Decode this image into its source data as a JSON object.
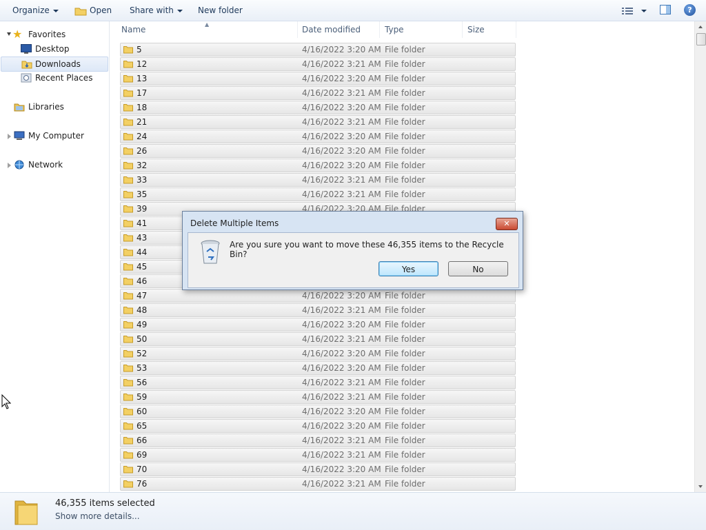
{
  "toolbar": {
    "organize": "Organize",
    "open": "Open",
    "share_with": "Share with",
    "new_folder": "New folder"
  },
  "nav": {
    "favorites": "Favorites",
    "desktop": "Desktop",
    "downloads": "Downloads",
    "recent_places": "Recent Places",
    "libraries": "Libraries",
    "my_computer": "My Computer",
    "network": "Network"
  },
  "columns": {
    "name": "Name",
    "date_modified": "Date modified",
    "type": "Type",
    "size": "Size"
  },
  "rows": [
    {
      "name": "5",
      "date": "4/16/2022 3:20 AM",
      "type": "File folder"
    },
    {
      "name": "12",
      "date": "4/16/2022 3:21 AM",
      "type": "File folder"
    },
    {
      "name": "13",
      "date": "4/16/2022 3:20 AM",
      "type": "File folder"
    },
    {
      "name": "17",
      "date": "4/16/2022 3:21 AM",
      "type": "File folder"
    },
    {
      "name": "18",
      "date": "4/16/2022 3:20 AM",
      "type": "File folder"
    },
    {
      "name": "21",
      "date": "4/16/2022 3:21 AM",
      "type": "File folder"
    },
    {
      "name": "24",
      "date": "4/16/2022 3:20 AM",
      "type": "File folder"
    },
    {
      "name": "26",
      "date": "4/16/2022 3:20 AM",
      "type": "File folder"
    },
    {
      "name": "32",
      "date": "4/16/2022 3:20 AM",
      "type": "File folder"
    },
    {
      "name": "33",
      "date": "4/16/2022 3:21 AM",
      "type": "File folder"
    },
    {
      "name": "35",
      "date": "4/16/2022 3:21 AM",
      "type": "File folder"
    },
    {
      "name": "39",
      "date": "4/16/2022 3:20 AM",
      "type": "File folder"
    },
    {
      "name": "41",
      "date": "",
      "type": ""
    },
    {
      "name": "43",
      "date": "",
      "type": ""
    },
    {
      "name": "44",
      "date": "",
      "type": ""
    },
    {
      "name": "45",
      "date": "",
      "type": ""
    },
    {
      "name": "46",
      "date": "",
      "type": ""
    },
    {
      "name": "47",
      "date": "4/16/2022 3:20 AM",
      "type": "File folder"
    },
    {
      "name": "48",
      "date": "4/16/2022 3:21 AM",
      "type": "File folder"
    },
    {
      "name": "49",
      "date": "4/16/2022 3:20 AM",
      "type": "File folder"
    },
    {
      "name": "50",
      "date": "4/16/2022 3:21 AM",
      "type": "File folder"
    },
    {
      "name": "52",
      "date": "4/16/2022 3:20 AM",
      "type": "File folder"
    },
    {
      "name": "53",
      "date": "4/16/2022 3:20 AM",
      "type": "File folder"
    },
    {
      "name": "56",
      "date": "4/16/2022 3:21 AM",
      "type": "File folder"
    },
    {
      "name": "59",
      "date": "4/16/2022 3:21 AM",
      "type": "File folder"
    },
    {
      "name": "60",
      "date": "4/16/2022 3:20 AM",
      "type": "File folder"
    },
    {
      "name": "65",
      "date": "4/16/2022 3:20 AM",
      "type": "File folder"
    },
    {
      "name": "66",
      "date": "4/16/2022 3:21 AM",
      "type": "File folder"
    },
    {
      "name": "69",
      "date": "4/16/2022 3:21 AM",
      "type": "File folder"
    },
    {
      "name": "70",
      "date": "4/16/2022 3:20 AM",
      "type": "File folder"
    },
    {
      "name": "76",
      "date": "4/16/2022 3:21 AM",
      "type": "File folder"
    }
  ],
  "details": {
    "count": "46,355 items selected",
    "more": "Show more details..."
  },
  "dialog": {
    "title": "Delete Multiple Items",
    "message": "Are you sure you want to move these 46,355 items to the Recycle Bin?",
    "yes": "Yes",
    "no": "No",
    "close_glyph": "✕"
  },
  "icons": {
    "help": "?",
    "star": "★"
  }
}
